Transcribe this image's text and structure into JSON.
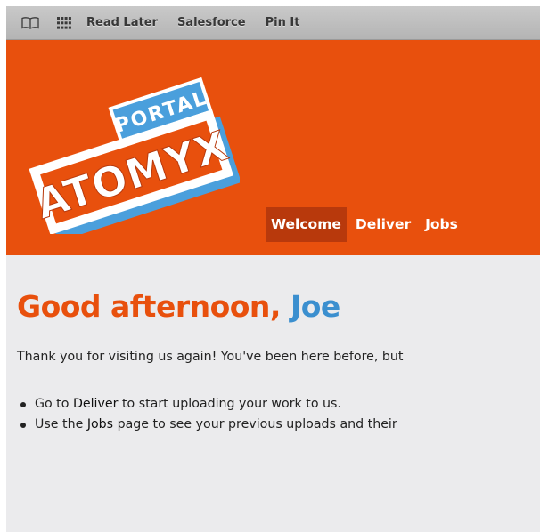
{
  "bookmarks_bar": {
    "icons": [
      "book-icon",
      "grid-icon"
    ],
    "links": [
      "Read Later",
      "Salesforce",
      "Pin It"
    ]
  },
  "header": {
    "logo_text": "ATOMYX",
    "logo_subtext": "PORTAL",
    "nav": [
      {
        "label": "Welcome",
        "active": true
      },
      {
        "label": "Deliver",
        "active": false
      },
      {
        "label": "Jobs",
        "active": false
      }
    ]
  },
  "main": {
    "greeting_prefix": "Good afternoon, ",
    "user_name": "Joe",
    "intro": "Thank you for visiting us again! You've been here before, but",
    "tips": [
      {
        "before": "Go to ",
        "link": "Deliver",
        "after": " to start uploading your work to us."
      },
      {
        "before": "Use the ",
        "link": "Jobs",
        "after": " page to see your previous uploads and their"
      }
    ]
  },
  "colors": {
    "brand_orange": "#e8500d",
    "active_nav": "#b8390c",
    "accent_blue": "#3b8fcf",
    "content_bg": "#ebebed"
  }
}
